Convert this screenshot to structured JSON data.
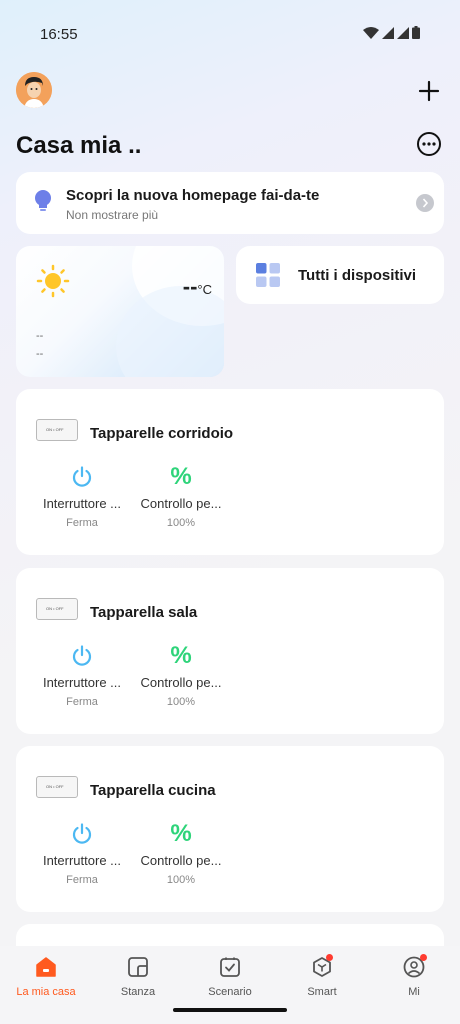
{
  "status_bar": {
    "time": "16:55"
  },
  "header": {
    "title": "Casa mia .."
  },
  "banner": {
    "title": "Scopri la nuova homepage fai-da-te",
    "subtitle": "Non mostrare più"
  },
  "weather": {
    "temperature": "--",
    "unit": "°C",
    "line1": "--",
    "line2": "--"
  },
  "all_devices": {
    "label": "Tutti i dispositivi"
  },
  "devices": [
    {
      "name": "Tapparelle corridoio",
      "chip": "ON • OFF",
      "controls": [
        {
          "label": "Interruttore ...",
          "value": "Ferma",
          "icon": "power-icon"
        },
        {
          "label": "Controllo pe...",
          "value": "100%",
          "icon": "percent-icon"
        }
      ]
    },
    {
      "name": "Tapparella sala",
      "chip": "ON • OFF",
      "controls": [
        {
          "label": "Interruttore ...",
          "value": "Ferma",
          "icon": "power-icon"
        },
        {
          "label": "Controllo pe...",
          "value": "100%",
          "icon": "percent-icon"
        }
      ]
    },
    {
      "name": "Tapparella cucina",
      "chip": "ON • OFF",
      "controls": [
        {
          "label": "Interruttore ...",
          "value": "Ferma",
          "icon": "power-icon"
        },
        {
          "label": "Controllo pe...",
          "value": "100%",
          "icon": "percent-icon"
        }
      ]
    }
  ],
  "tabs": [
    {
      "label": "La mia casa",
      "icon": "home-icon",
      "active": true
    },
    {
      "label": "Stanza",
      "icon": "room-icon"
    },
    {
      "label": "Scenario",
      "icon": "scenario-icon"
    },
    {
      "label": "Smart",
      "icon": "smart-icon",
      "badge": true
    },
    {
      "label": "Mi",
      "icon": "profile-icon",
      "badge": true
    }
  ],
  "colors": {
    "accent": "#ff5a1f",
    "power": "#4cb8f2",
    "percent": "#2ed47a",
    "badge": "#ff3b30"
  }
}
